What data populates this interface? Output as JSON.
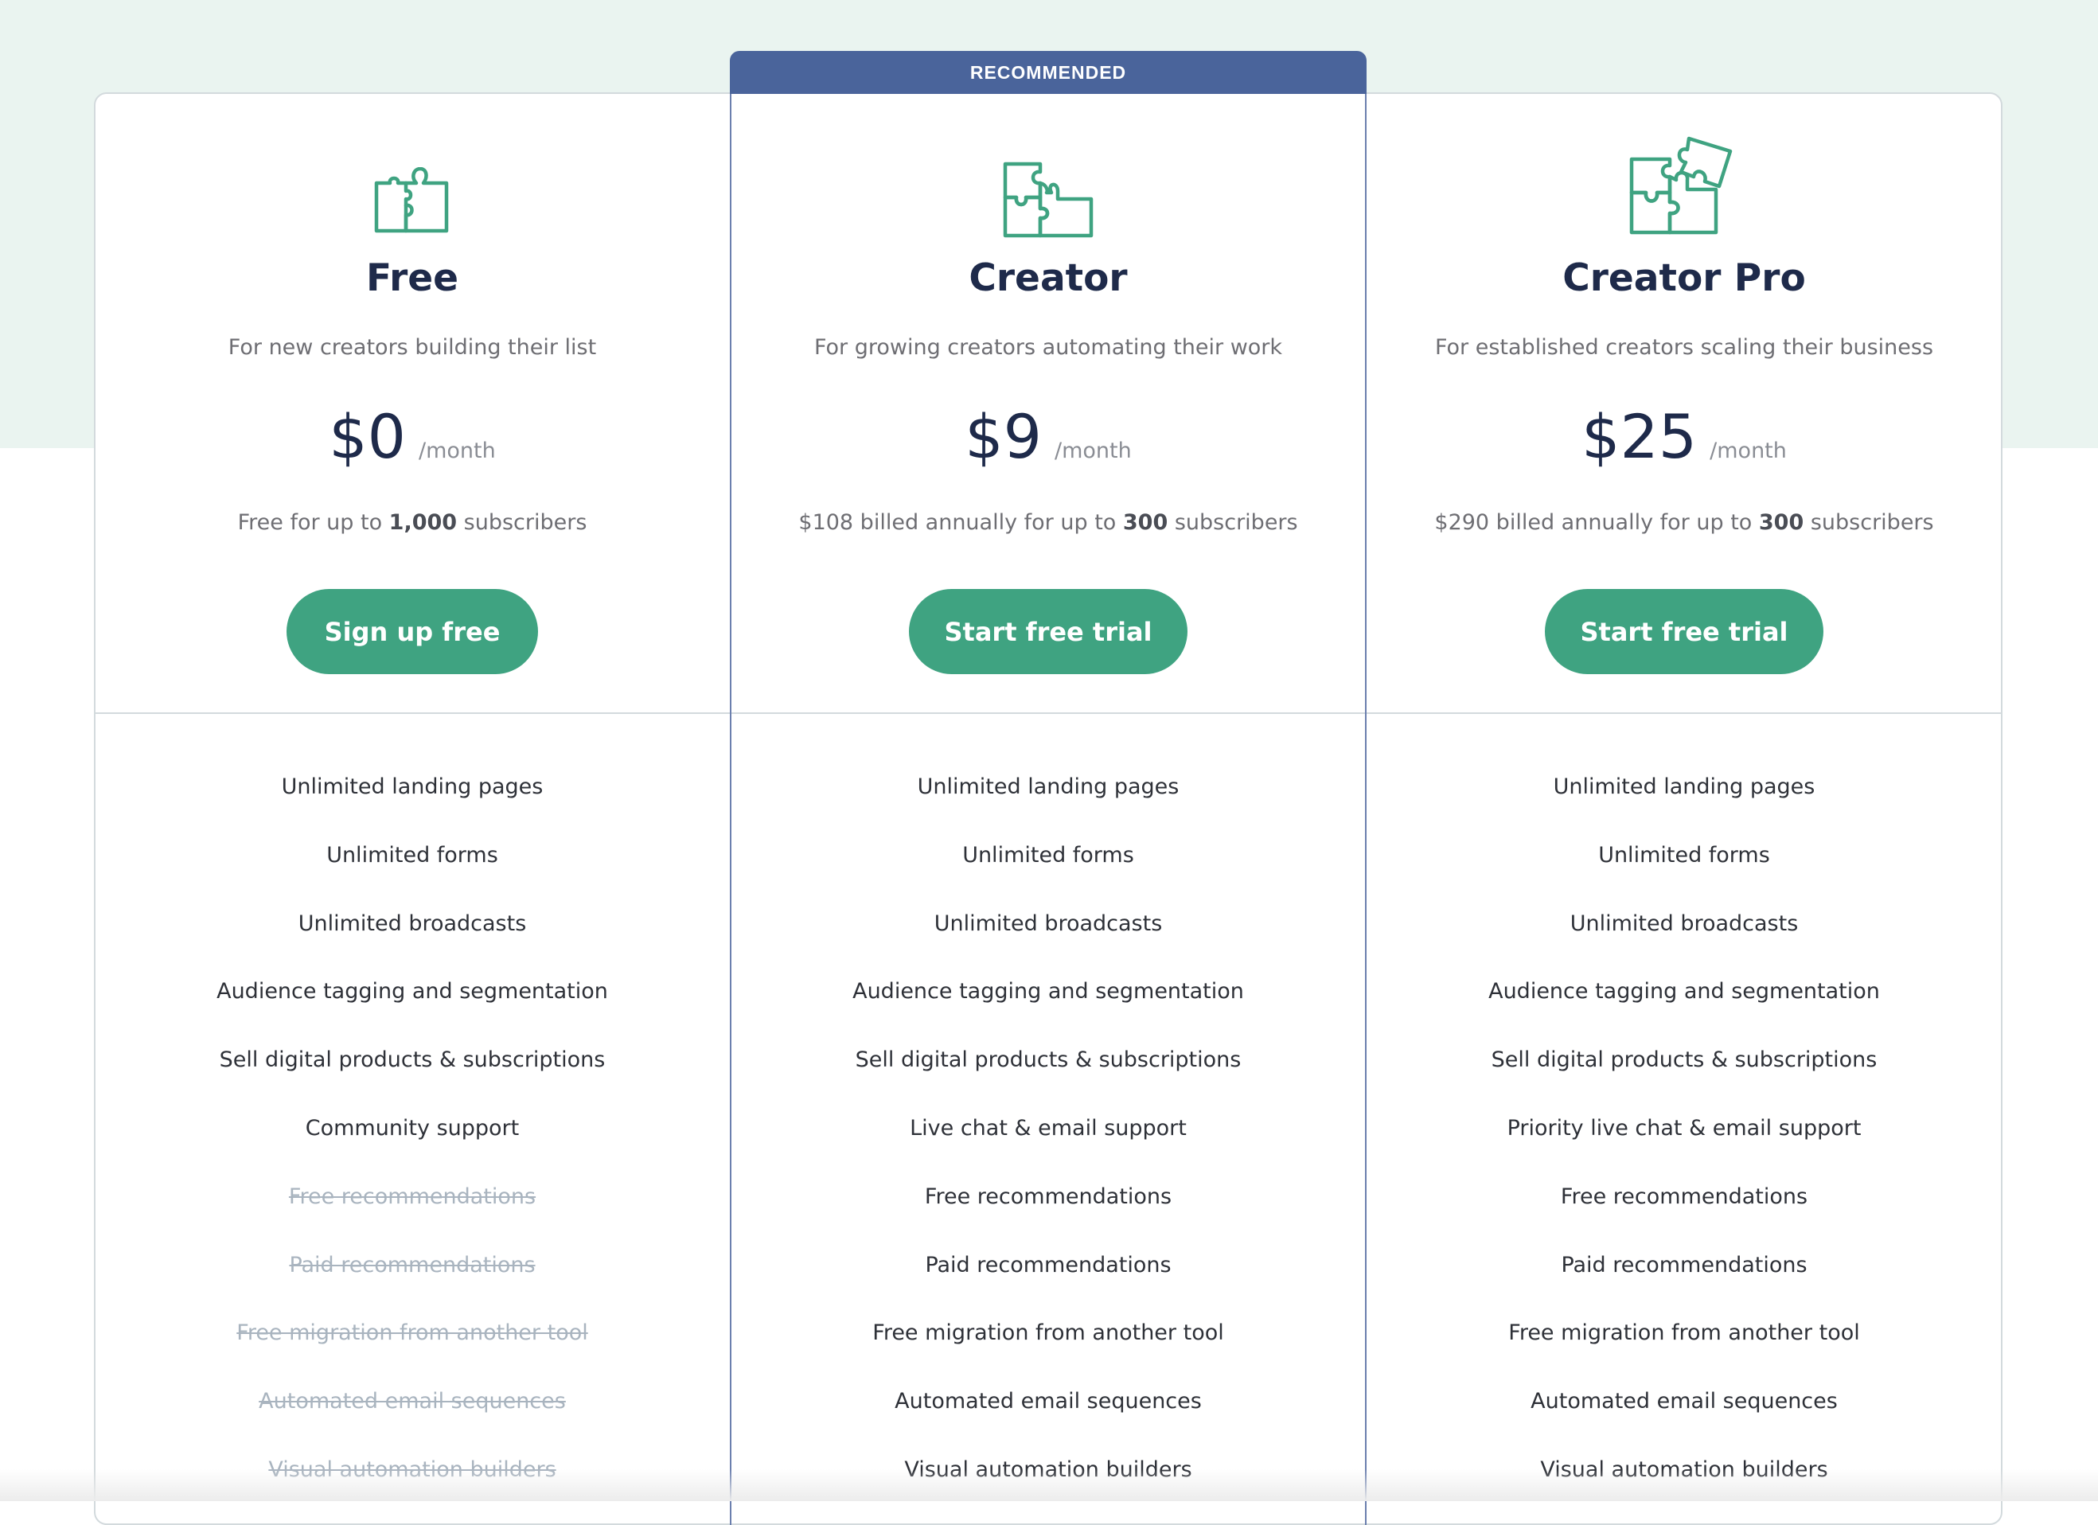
{
  "colors": {
    "accent_green": "#3fa381",
    "recommended_blue": "#4a649b",
    "heading_navy": "#1e2a4a",
    "band_mint": "#eaf4f0",
    "disabled_gray": "#a9b4bf"
  },
  "recommended_badge": "RECOMMENDED",
  "plans": [
    {
      "icon": "puzzle-piece-icon",
      "name": "Free",
      "tagline": "For new creators building their list",
      "price": "$0",
      "period": "/month",
      "billing_prefix": "Free for up to ",
      "billing_bold": "1,000",
      "billing_suffix": " subscribers",
      "cta": "Sign up free",
      "features": [
        {
          "label": "Unlimited landing pages",
          "included": true
        },
        {
          "label": "Unlimited forms",
          "included": true
        },
        {
          "label": "Unlimited broadcasts",
          "included": true
        },
        {
          "label": "Audience tagging and segmentation",
          "included": true
        },
        {
          "label": "Sell digital products & subscriptions",
          "included": true
        },
        {
          "label": "Community support",
          "included": true
        },
        {
          "label": "Free recommendations",
          "included": false
        },
        {
          "label": "Paid recommendations",
          "included": false
        },
        {
          "label": "Free migration from another tool",
          "included": false
        },
        {
          "label": "Automated email sequences",
          "included": false
        },
        {
          "label": "Visual automation builders",
          "included": false
        }
      ]
    },
    {
      "icon": "puzzle-pieces-icon",
      "name": "Creator",
      "tagline": "For growing creators automating their work",
      "price": "$9",
      "period": "/month",
      "billing_prefix": "$108 billed annually for up to ",
      "billing_bold": "300",
      "billing_suffix": " subscribers",
      "cta": "Start free trial",
      "recommended": true,
      "features": [
        {
          "label": "Unlimited landing pages",
          "included": true
        },
        {
          "label": "Unlimited forms",
          "included": true
        },
        {
          "label": "Unlimited broadcasts",
          "included": true
        },
        {
          "label": "Audience tagging and segmentation",
          "included": true
        },
        {
          "label": "Sell digital products & subscriptions",
          "included": true
        },
        {
          "label": "Live chat & email support",
          "included": true
        },
        {
          "label": "Free recommendations",
          "included": true
        },
        {
          "label": "Paid recommendations",
          "included": true
        },
        {
          "label": "Free migration from another tool",
          "included": true
        },
        {
          "label": "Automated email sequences",
          "included": true
        },
        {
          "label": "Visual automation builders",
          "included": true
        }
      ]
    },
    {
      "icon": "puzzle-complete-icon",
      "name": "Creator Pro",
      "tagline": "For established creators scaling their business",
      "price": "$25",
      "period": "/month",
      "billing_prefix": "$290 billed annually for up to ",
      "billing_bold": "300",
      "billing_suffix": " subscribers",
      "cta": "Start free trial",
      "features": [
        {
          "label": "Unlimited landing pages",
          "included": true
        },
        {
          "label": "Unlimited forms",
          "included": true
        },
        {
          "label": "Unlimited broadcasts",
          "included": true
        },
        {
          "label": "Audience tagging and segmentation",
          "included": true
        },
        {
          "label": "Sell digital products & subscriptions",
          "included": true
        },
        {
          "label": "Priority live chat & email support",
          "included": true
        },
        {
          "label": "Free recommendations",
          "included": true
        },
        {
          "label": "Paid recommendations",
          "included": true
        },
        {
          "label": "Free migration from another tool",
          "included": true
        },
        {
          "label": "Automated email sequences",
          "included": true
        },
        {
          "label": "Visual automation builders",
          "included": true
        }
      ]
    }
  ]
}
